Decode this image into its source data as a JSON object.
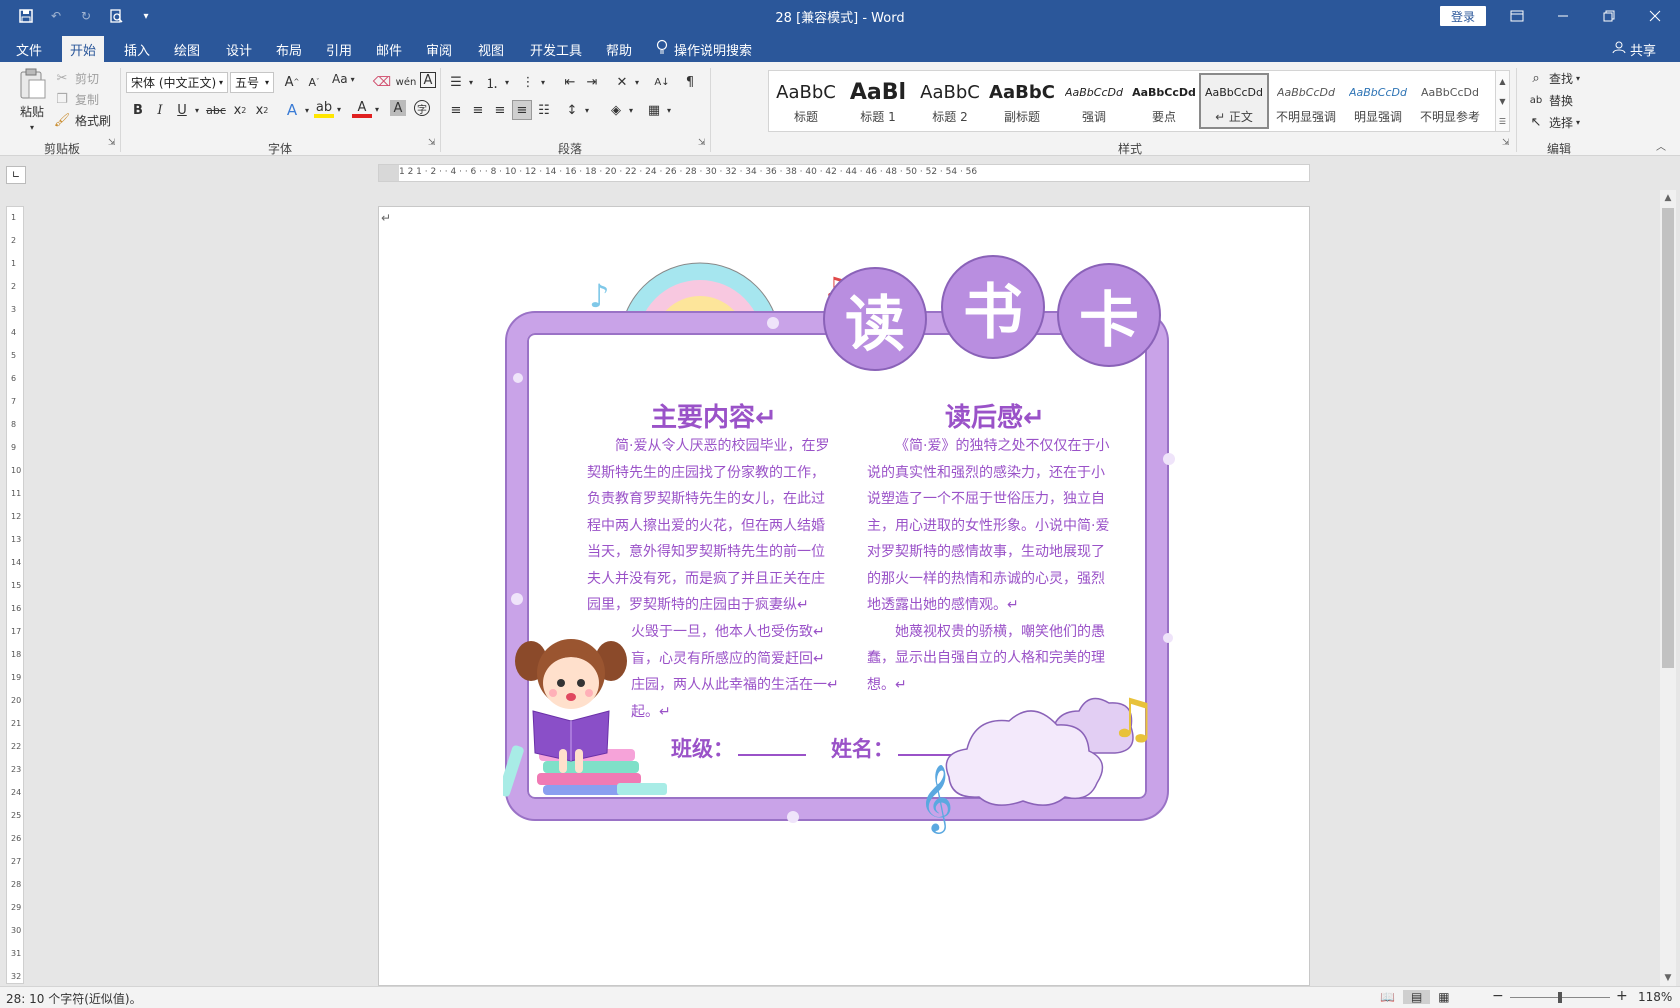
{
  "window": {
    "title": "28 [兼容模式] - Word",
    "login_label": "登录"
  },
  "tabs": [
    "文件",
    "开始",
    "插入",
    "绘图",
    "设计",
    "布局",
    "引用",
    "邮件",
    "审阅",
    "视图",
    "开发工具",
    "帮助"
  ],
  "tell_me": "操作说明搜索",
  "share_label": "共享",
  "ribbon": {
    "clipboard": {
      "paste": "粘贴",
      "cut": "剪切",
      "copy": "复制",
      "format_painter": "格式刷",
      "group": "剪贴板"
    },
    "font": {
      "font_name": "宋体 (中文正文)",
      "font_size": "五号",
      "change_case": "Aa",
      "group": "字体"
    },
    "paragraph": {
      "group": "段落"
    },
    "styles": {
      "group": "样式",
      "items": [
        {
          "sample": "AaBbC",
          "name": "标题"
        },
        {
          "sample": "AaBl",
          "name": "标题 1"
        },
        {
          "sample": "AaBbC",
          "name": "标题 2"
        },
        {
          "sample": "AaBbC",
          "name": "副标题"
        },
        {
          "sample": "AaBbCcDd",
          "name": "强调"
        },
        {
          "sample": "AaBbCcDd",
          "name": "要点"
        },
        {
          "sample": "AaBbCcDd",
          "name": "↵ 正文"
        },
        {
          "sample": "AaBbCcDd",
          "name": "不明显强调"
        },
        {
          "sample": "AaBbCcDd",
          "name": "明显强调"
        },
        {
          "sample": "AaBbCcDd",
          "name": "不明显参考"
        }
      ]
    },
    "editing": {
      "find": "查找",
      "replace": "替换",
      "select": "选择",
      "group": "编辑"
    }
  },
  "ruler": {
    "h_ticks": "1 2 1 · 2 · · 4 · · 6 · · 8 · 10 · 12 · 14 · 16 · 18 · 20 · 22 · 24 · 26 · 28 · 30 · 32 · 34 · 36 · 38 · 40 · 42 · 44 · 46 · 48 · 50 · 52 · 54 · 56",
    "v_ticks": [
      "1",
      "2",
      "1",
      "2",
      "3",
      "4",
      "5",
      "6",
      "7",
      "8",
      "9",
      "10",
      "11",
      "12",
      "13",
      "14",
      "15",
      "16",
      "17",
      "18",
      "19",
      "20",
      "21",
      "22",
      "23",
      "24",
      "25",
      "26",
      "27",
      "28",
      "29",
      "30",
      "31",
      "32"
    ]
  },
  "card": {
    "title_chars": [
      "读",
      "书",
      "卡"
    ],
    "left_heading": "主要内容↵",
    "left_text_lines": [
      "简·爱从令人厌恶的校园毕业，在罗",
      "契斯特先生的庄园找了份家教的工作，",
      "负责教育罗契斯特先生的女儿，在此过",
      "程中两人擦出爱的火花，但在两人结婚",
      "当天，意外得知罗契斯特先生的前一位",
      "夫人并没有死，而是疯了并且正关在庄",
      "园里，罗契斯特的庄园由于疯妻纵↵"
    ],
    "left_text_lines_2": [
      "火毁于一旦，他本人也受伤致↵",
      "盲，心灵有所感应的简爱赶回↵",
      "庄园，两人从此幸福的生活在一↵",
      "起。↵"
    ],
    "right_heading": "读后感↵",
    "right_text_lines": [
      "《简·爱》的独特之处不仅仅在于小",
      "说的真实性和强烈的感染力，还在于小",
      "说塑造了一个不屈于世俗压力，独立自",
      "主，用心进取的女性形象。小说中简·爱",
      "对罗契斯特的感情故事，生动地展现了",
      "的那火一样的热情和赤诚的心灵，强烈",
      "地透露出她的感情观。↵",
      "她蔑视权贵的骄横，嘲笑他们的愚",
      "蠢，显示出自强自立的人格和完美的理",
      "想。↵"
    ],
    "class_label": "班级：",
    "name_label": "姓名：",
    "end_mark": "↵"
  },
  "status": {
    "word_count": "28: 10 个字符(近似值)。",
    "zoom": "118%"
  },
  "colors": {
    "word_blue": "#2b579a",
    "card_purple": "#9a52c8",
    "frame_lavender": "#c9a3e8"
  }
}
